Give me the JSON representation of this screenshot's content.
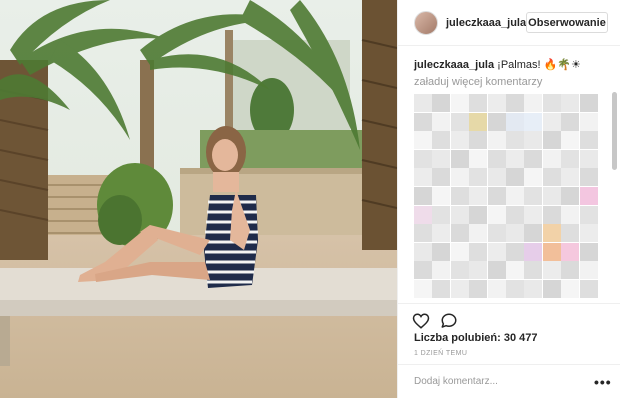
{
  "post": {
    "username": "juleczkaaa_jula",
    "follow_label": "Obserwowanie",
    "caption_username": "juleczkaaa_jula",
    "caption_text": "¡Palmas! 🔥🌴☀",
    "load_more": "załaduj więcej komentarzy",
    "likes": "Liczba polubień: 30 477",
    "time": "1 DZIEŃ TEMU",
    "add_comment_placeholder": "Dodaj komentarz...",
    "more_options": "•••"
  },
  "icons": {
    "heart": "heart-icon",
    "comment": "comment-icon"
  },
  "colors": {
    "text": "#262626",
    "secondary_text": "#999999",
    "border": "#efefef"
  },
  "photo": {
    "subject": "photo-of-girl-in-striped-dress-sitting-on-bench-under-palms"
  }
}
